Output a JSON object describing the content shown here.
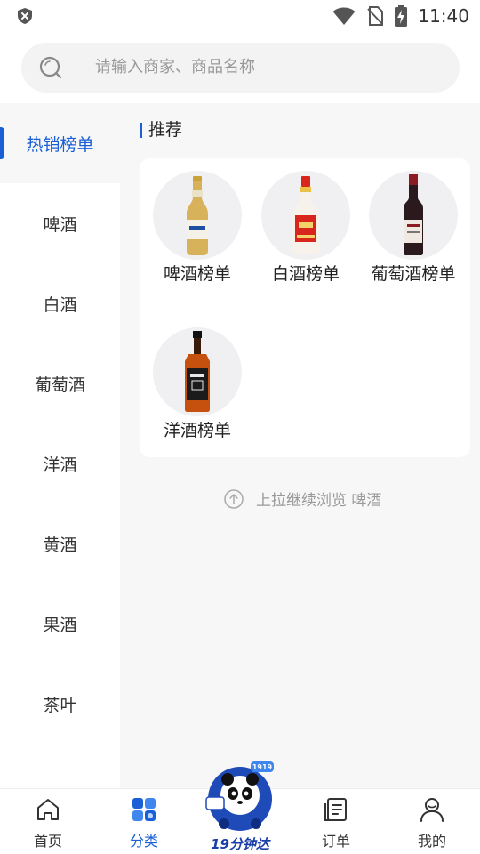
{
  "status_bar": {
    "time": "11:40",
    "icons": [
      "shield-x-icon",
      "wifi-icon",
      "no-sim-icon",
      "battery-charging-icon"
    ]
  },
  "search": {
    "placeholder": "请输入商家、商品名称",
    "icon": "search-icon"
  },
  "sidebar": {
    "items": [
      {
        "label": "热销榜单",
        "active": true
      },
      {
        "label": "啤酒"
      },
      {
        "label": "白酒"
      },
      {
        "label": "葡萄酒"
      },
      {
        "label": "洋酒"
      },
      {
        "label": "黄酒"
      },
      {
        "label": "果酒"
      },
      {
        "label": "茶叶"
      }
    ]
  },
  "main": {
    "section_title": "推荐",
    "recommend": [
      {
        "label": "啤酒榜单",
        "image": "beer-bottle-image"
      },
      {
        "label": "白酒榜单",
        "image": "baijiu-bottle-image"
      },
      {
        "label": "葡萄酒榜单",
        "image": "wine-bottle-image"
      },
      {
        "label": "洋酒榜单",
        "image": "whiskey-bottle-image"
      }
    ],
    "pull_hint": "上拉继续浏览 啤酒"
  },
  "tab_bar": {
    "tabs": [
      {
        "label": "首页",
        "icon": "home-icon"
      },
      {
        "label": "分类",
        "icon": "category-icon",
        "active": true
      },
      {
        "label": "订单",
        "icon": "order-icon"
      },
      {
        "label": "我的",
        "icon": "profile-icon"
      }
    ],
    "promo_label": "19分钟达",
    "promo_badge": "1919"
  },
  "colors": {
    "accent": "#1a5fd6",
    "content_background": "#f7f7f8"
  }
}
